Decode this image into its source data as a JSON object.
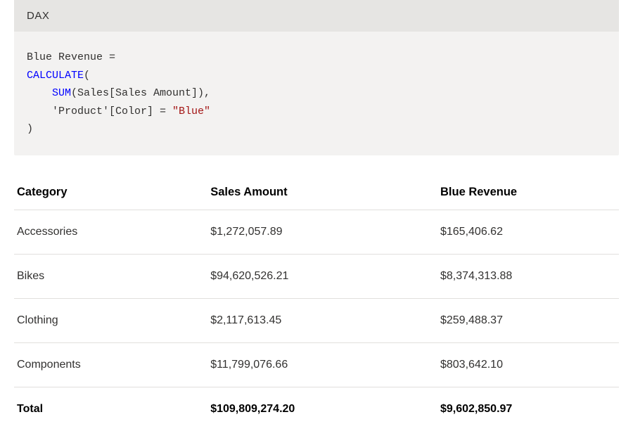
{
  "code": {
    "language_label": "DAX",
    "line1_plain": "Blue Revenue =",
    "line2_kw": "CALCULATE",
    "line2_after": "(",
    "line3_indent": "    ",
    "line3_kw": "SUM",
    "line3_after": "(Sales[Sales Amount]),",
    "line4_indent": "    ",
    "line4_before": "'Product'[Color] = ",
    "line4_str": "\"Blue\"",
    "line5_plain": ")"
  },
  "table": {
    "headers": {
      "col0": "Category",
      "col1": "Sales Amount",
      "col2": "Blue Revenue"
    },
    "rows": [
      {
        "c0": "Accessories",
        "c1": "$1,272,057.89",
        "c2": "$165,406.62"
      },
      {
        "c0": "Bikes",
        "c1": "$94,620,526.21",
        "c2": "$8,374,313.88"
      },
      {
        "c0": "Clothing",
        "c1": "$2,117,613.45",
        "c2": "$259,488.37"
      },
      {
        "c0": "Components",
        "c1": "$11,799,076.66",
        "c2": "$803,642.10"
      }
    ],
    "total": {
      "c0": "Total",
      "c1": "$109,809,274.20",
      "c2": "$9,602,850.97"
    }
  }
}
